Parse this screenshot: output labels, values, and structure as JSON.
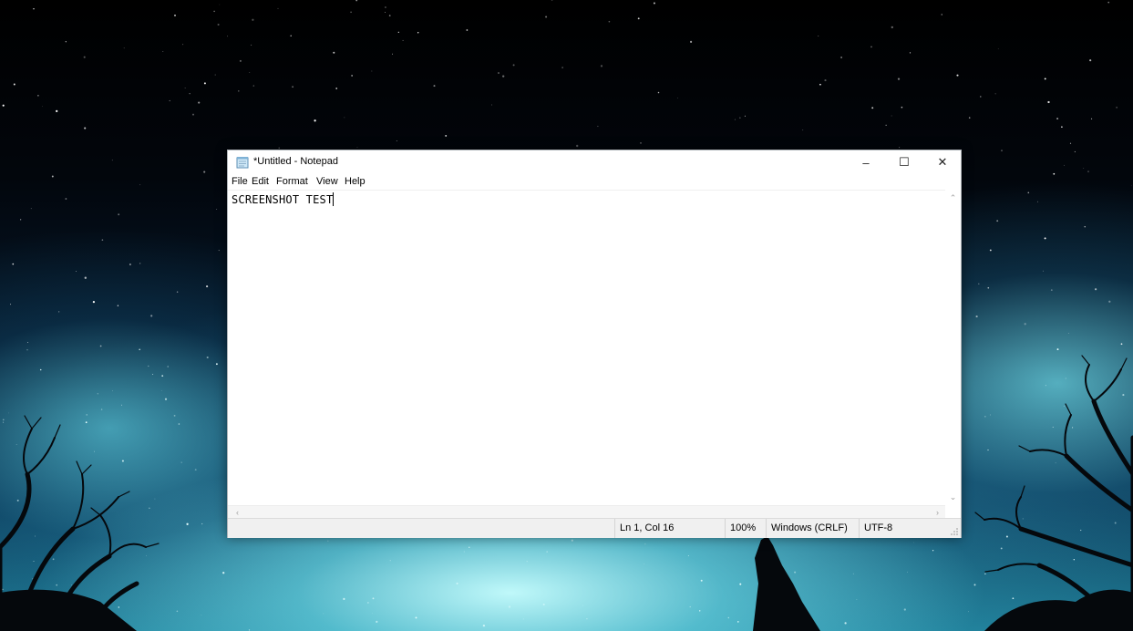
{
  "window": {
    "title": "*Untitled - Notepad",
    "controls": {
      "minimize": "–",
      "maximize": "☐",
      "close": "✕"
    }
  },
  "menu": [
    "File",
    "Edit",
    "Format",
    "View",
    "Help"
  ],
  "editor": {
    "text": "SCREENSHOT TEST"
  },
  "scrollbars": {
    "up": "⌃",
    "down": "⌄",
    "left": "‹",
    "right": "›"
  },
  "status": {
    "position": "Ln 1, Col 16",
    "zoom": "100%",
    "line_ending": "Windows (CRLF)",
    "encoding": "UTF-8"
  },
  "colors": {
    "window_bg": "#ffffff",
    "statusbar_bg": "#f0f0f0",
    "sky_top": "#000000",
    "sky_glow": "#7fe6f0"
  },
  "icons": {
    "app": "notepad-icon",
    "minimize": "minimize-icon",
    "maximize": "maximize-icon",
    "close": "close-icon"
  }
}
